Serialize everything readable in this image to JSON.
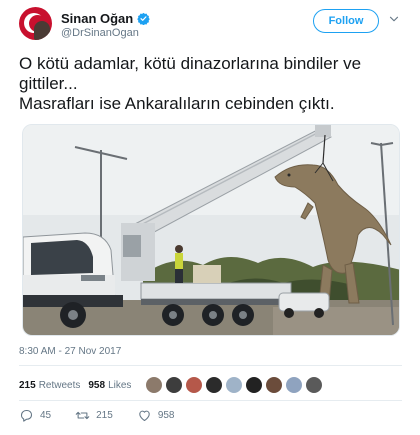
{
  "author": {
    "display_name": "Sinan Oğan",
    "handle": "@DrSinanOgan",
    "verified_icon": "verified-badge-icon",
    "avatar_icon": "profile-avatar"
  },
  "follow_label": "Follow",
  "tweet": {
    "lines": [
      "O kötü adamlar, kötü dinazorlarına bindiler ve gittiler...",
      "Masrafları ise Ankaralıların cebinden çıktı."
    ]
  },
  "media": {
    "description_icon": "photo-crane-truck-dinosaur"
  },
  "timestamp": "8:30 AM - 27 Nov 2017",
  "stats": {
    "retweets_count": "215",
    "retweets_label": "Retweets",
    "likes_count": "958",
    "likes_label": "Likes"
  },
  "likers": [
    "#8c7a6b",
    "#3d3d3d",
    "#b5584a",
    "#2b2b2b",
    "#9fb3c8",
    "#222222",
    "#6b4c3b",
    "#8fa3bf",
    "#5a5a5a"
  ],
  "actions": {
    "reply_count": "45",
    "retweet_count": "215",
    "like_count": "958"
  },
  "colors": {
    "accent": "#1da1f2",
    "text": "#14171a",
    "muted": "#657786"
  }
}
